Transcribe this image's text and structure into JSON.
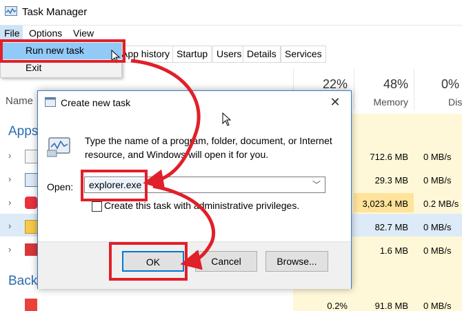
{
  "window": {
    "title": "Task Manager"
  },
  "menu": {
    "file": "File",
    "options": "Options",
    "view": "View"
  },
  "file_menu": {
    "run_new_task": "Run new task",
    "exit": "Exit"
  },
  "tabs": [
    "App history",
    "Startup",
    "Users",
    "Details",
    "Services"
  ],
  "columns": {
    "name": "Name",
    "cpu_pct": "22%",
    "memory_pct": "48%",
    "disk_pct": "0%",
    "memory_label": "Memory",
    "disk_label": "Disk"
  },
  "sections": {
    "apps": "Apps",
    "background": "Back"
  },
  "rows": [
    {
      "memory": "712.6 MB",
      "disk": "0 MB/s"
    },
    {
      "memory": "29.3 MB",
      "disk": "0 MB/s"
    },
    {
      "memory": "3,023.4 MB",
      "disk": "0.2 MB/s"
    },
    {
      "memory": "82.7 MB",
      "disk": "0 MB/s"
    },
    {
      "memory": "1.6 MB",
      "disk": "0 MB/s"
    },
    {
      "cpu": "0.2%",
      "memory": "91.8 MB",
      "disk": "0 MB/s"
    }
  ],
  "dialog": {
    "title": "Create new task",
    "description": "Type the name of a program, folder, document, or Internet resource, and Windows will open it for you.",
    "open_label": "Open:",
    "open_value": "explorer.exe",
    "admin_label": "Create this task with administrative privileges.",
    "ok": "OK",
    "cancel": "Cancel",
    "browse": "Browse...",
    "close_glyph": "✕"
  },
  "colors": {
    "highlight": "#e0202a",
    "accent": "#0078d7",
    "memory_tint": "#fff4c4",
    "memory_tint_strong": "#ffe9a0"
  }
}
